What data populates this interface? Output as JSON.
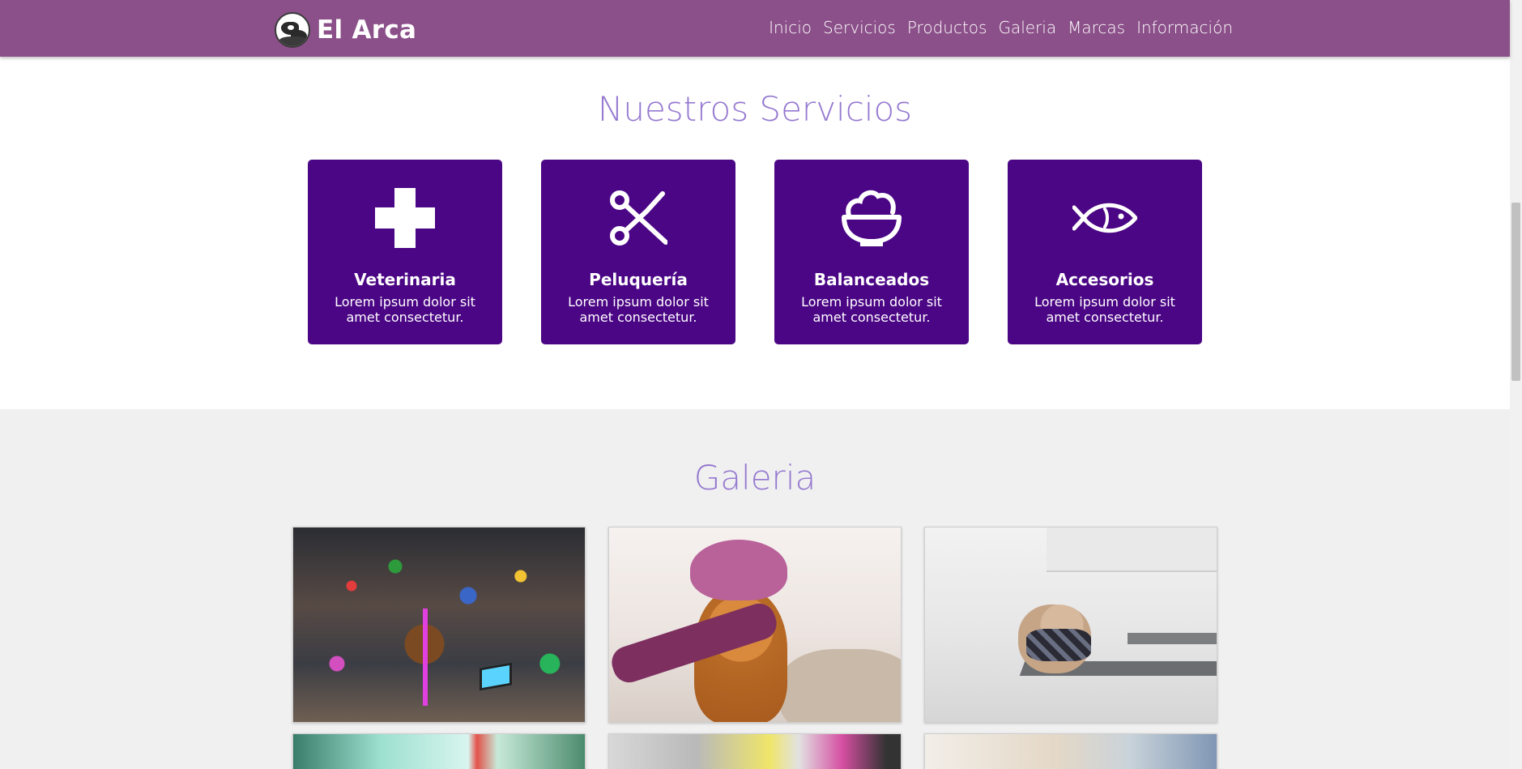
{
  "navbar": {
    "brand": "El Arca",
    "links": [
      "Inicio",
      "Servicios",
      "Productos",
      "Galeria",
      "Marcas",
      "Información"
    ]
  },
  "services": {
    "title": "Nuestros Servicios",
    "cards": [
      {
        "title": "Veterinaria",
        "text": "Lorem ipsum dolor sit amet consectetur.",
        "icon": "plus-icon"
      },
      {
        "title": "Peluquería",
        "text": "Lorem ipsum dolor sit amet consectetur.",
        "icon": "scissors-icon"
      },
      {
        "title": "Balanceados",
        "text": "Lorem ipsum dolor sit amet consectetur.",
        "icon": "food-bowl-icon"
      },
      {
        "title": "Accesorios",
        "text": "Lorem ipsum dolor sit amet consectetur.",
        "icon": "fish-icon"
      }
    ]
  },
  "gallery": {
    "title": "Galeria"
  },
  "colors": {
    "navbar": "#8b5089",
    "card": "#4b0685",
    "section_title": "#9579d0",
    "gallery_bg": "#f0f0f0"
  }
}
